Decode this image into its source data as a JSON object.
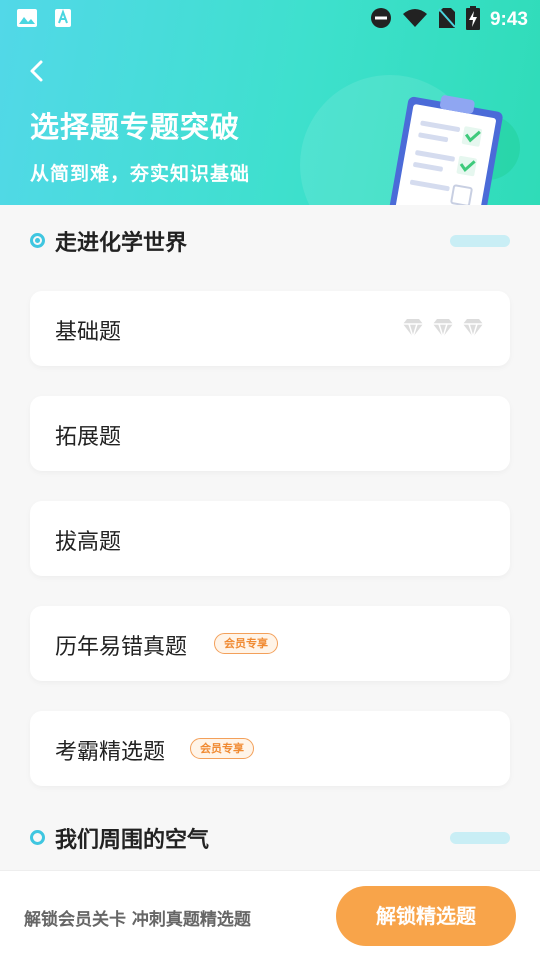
{
  "status_bar": {
    "time": "9:43",
    "left_icons": [
      "image-icon",
      "a-font-icon"
    ],
    "right_icons": [
      "do-not-disturb-icon",
      "wifi-icon",
      "no-sim-icon",
      "battery-charging-icon"
    ]
  },
  "header": {
    "title": "选择题专题突破",
    "subtitle": "从简到难，夯实知识基础",
    "gradient": [
      "#52d8e8",
      "#2fdcb8"
    ]
  },
  "sections": [
    {
      "title": "走进化学世界",
      "items": [
        {
          "label": "基础题",
          "gems": 3
        },
        {
          "label": "拓展题"
        },
        {
          "label": "拔高题"
        },
        {
          "label": "历年易错真题",
          "badge": "会员专享"
        },
        {
          "label": "考霸精选题",
          "badge": "会员专享"
        }
      ]
    },
    {
      "title": "我们周围的空气",
      "items": []
    }
  ],
  "bottom_bar": {
    "text": "解锁会员关卡  冲刺真题精选题",
    "button_label": "解锁精选题",
    "button_color": "#f8a44a"
  }
}
